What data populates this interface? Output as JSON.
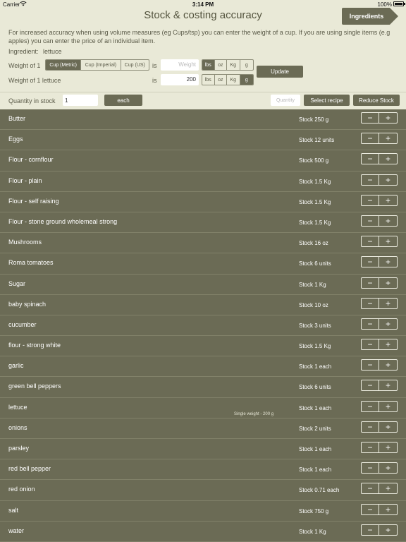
{
  "status": {
    "carrier": "Carrier",
    "time": "3:14 PM",
    "battery": "100%"
  },
  "header": {
    "title": "Stock & costing accuracy",
    "ingredients_button": "Ingredients"
  },
  "info_text": "For increased accuracy when using volume measures (eg Cups/tsp) you can enter the weight of a cup. If you are using single items (e.g apples) you can enter the price of an individual item.",
  "ingredient": {
    "label": "Ingredient:",
    "value": "lettuce"
  },
  "weight_row1": {
    "label": "Weight of 1",
    "cup_options": [
      "Cup (Metric)",
      "Cup (Imperial)",
      "Cup (US)"
    ],
    "is": "is",
    "weight_placeholder": "Weight",
    "unit_options": [
      "lbs",
      "oz",
      "Kg",
      "g"
    ]
  },
  "weight_row2": {
    "label": "Weight of 1  lettuce",
    "is": "is",
    "value": "200",
    "unit_options": [
      "lbs",
      "oz",
      "Kg",
      "g"
    ]
  },
  "update_button": "Update",
  "quantity_bar": {
    "label": "Quantity in stock",
    "value": "1",
    "unit_button": "each",
    "search_placeholder": "Quantity",
    "select_recipe": "Select recipe",
    "reduce_stock": "Reduce Stock"
  },
  "items": [
    {
      "name": "Butter",
      "stock": "Stock  250 g"
    },
    {
      "name": "Eggs",
      "stock": "Stock  12 units"
    },
    {
      "name": "Flour - cornflour",
      "stock": "Stock  500 g"
    },
    {
      "name": "Flour - plain",
      "stock": "Stock  1.5 Kg"
    },
    {
      "name": "Flour - self raising",
      "stock": "Stock  1.5 Kg"
    },
    {
      "name": "Flour - stone ground wholemeal strong",
      "stock": "Stock  1.5 Kg"
    },
    {
      "name": "Mushrooms",
      "stock": "Stock  16 oz"
    },
    {
      "name": "Roma tomatoes",
      "stock": "Stock  6 units"
    },
    {
      "name": "Sugar",
      "stock": "Stock  1 Kg"
    },
    {
      "name": "baby spinach",
      "stock": "Stock  10 oz"
    },
    {
      "name": "cucumber",
      "stock": "Stock  3 units"
    },
    {
      "name": "flour - strong white",
      "stock": "Stock  1.5 Kg"
    },
    {
      "name": "garlic",
      "stock": "Stock  1 each"
    },
    {
      "name": "green bell peppers",
      "stock": "Stock  6 units"
    },
    {
      "name": "lettuce",
      "stock": "Stock  1 each",
      "note": "Single weight -  200 g"
    },
    {
      "name": "onions",
      "stock": "Stock  2 units"
    },
    {
      "name": "parsley",
      "stock": "Stock  1 each"
    },
    {
      "name": "red bell pepper",
      "stock": "Stock  1 each"
    },
    {
      "name": "red onion",
      "stock": "Stock  0.71 each"
    },
    {
      "name": "salt",
      "stock": "Stock  750 g"
    },
    {
      "name": "water",
      "stock": "Stock  1 Kg"
    }
  ],
  "stepper": {
    "minus": "−",
    "plus": "+"
  }
}
